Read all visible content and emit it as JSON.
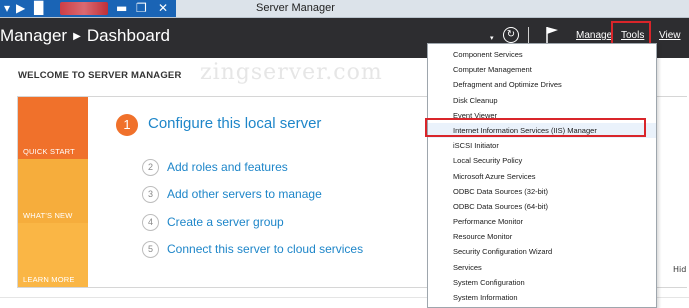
{
  "window": {
    "title": "Server Manager"
  },
  "header": {
    "breadcrumb_app": "Manager",
    "breadcrumb_page": "Dashboard",
    "menus": {
      "manage": "Manage",
      "tools": "Tools",
      "view": "View"
    }
  },
  "main": {
    "welcome_title": "WELCOME TO SERVER MANAGER",
    "watermark": "zingserver.com",
    "tiles": {
      "quick_start": "QUICK START",
      "whats_new": "WHAT'S NEW",
      "learn_more": "LEARN MORE"
    },
    "steps": [
      {
        "num": "1",
        "label": "Configure this local server"
      },
      {
        "num": "2",
        "label": "Add roles and features"
      },
      {
        "num": "3",
        "label": "Add other servers to manage"
      },
      {
        "num": "4",
        "label": "Create a server group"
      },
      {
        "num": "5",
        "label": "Connect this server to cloud services"
      }
    ],
    "hide_label": "Hid"
  },
  "tools_menu": {
    "items": [
      "Component Services",
      "Computer Management",
      "Defragment and Optimize Drives",
      "Disk Cleanup",
      "Event Viewer",
      "Internet Information Services (IIS) Manager",
      "iSCSI Initiator",
      "Local Security Policy",
      "Microsoft Azure Services",
      "ODBC Data Sources (32-bit)",
      "ODBC Data Sources (64-bit)",
      "Performance Monitor",
      "Resource Monitor",
      "Security Configuration Wizard",
      "Services",
      "System Configuration",
      "System Information"
    ],
    "highlighted_item": "Internet Information Services (IIS) Manager"
  },
  "colors": {
    "header_bg": "#2d2d30",
    "accent_blue": "#1e86c9",
    "quick_start": "#f0712b",
    "whats_new": "#f6ad3c",
    "learn_more": "#fab645",
    "highlight_red": "#d9252a"
  }
}
